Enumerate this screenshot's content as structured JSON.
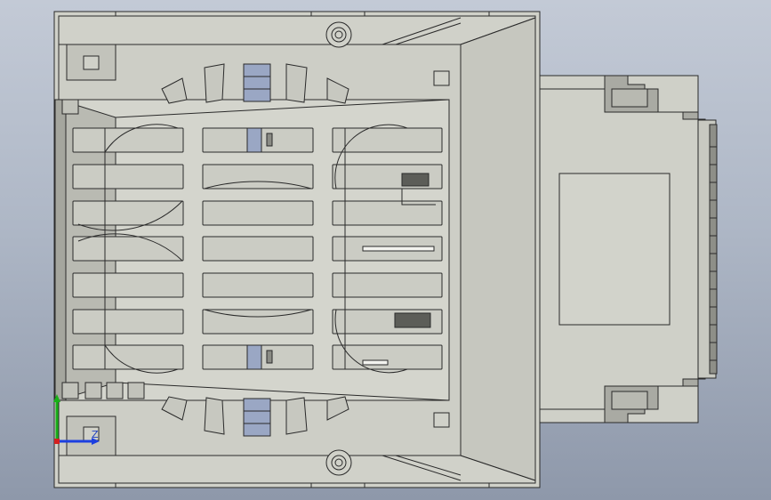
{
  "viewport": {
    "background_top": "#c3cad6",
    "background_bottom": "#8e98aa"
  },
  "model": {
    "body_color": "#cfd0c8",
    "edge_color": "#2a2a2a",
    "highlight_color": "#9aa7c4"
  },
  "triad": {
    "z_label": "Z",
    "x_color": "#1c3fe0",
    "y_color": "#19b019"
  }
}
